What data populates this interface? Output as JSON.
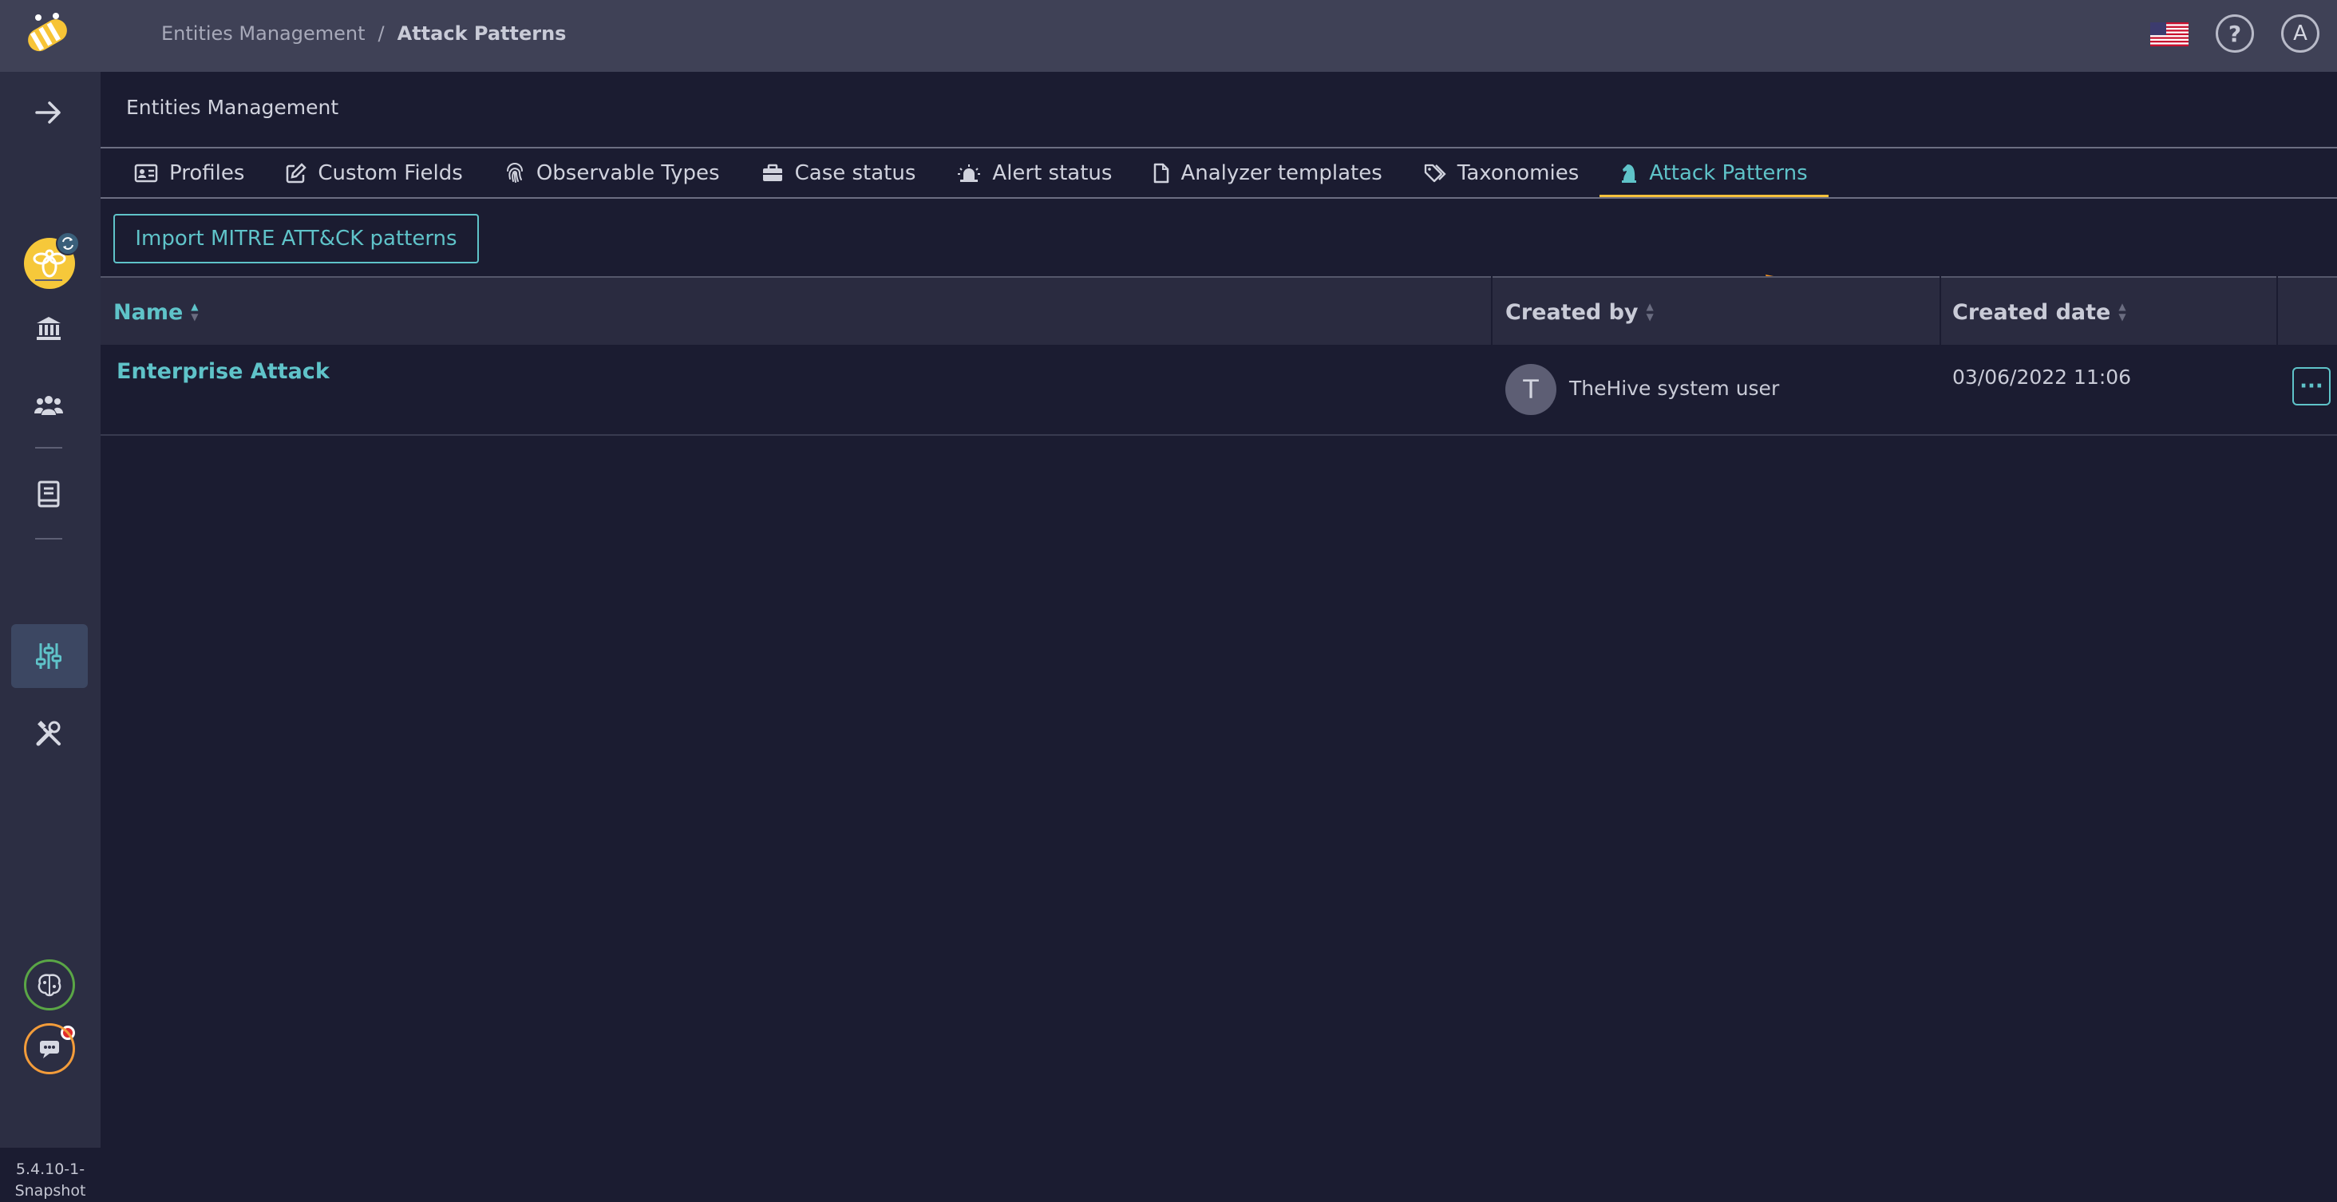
{
  "header": {
    "breadcrumb": [
      "Entities Management",
      "Attack Patterns"
    ],
    "separator": "/",
    "help_symbol": "?",
    "user_initial": "A"
  },
  "sidebar": {
    "icons": [
      "arrow-right-icon",
      "organisation-avatar",
      "institution-icon",
      "users-icon",
      "book-icon",
      "sliders-icon",
      "tools-icon"
    ],
    "active": "sliders-icon",
    "version": [
      "5.4.10-1-",
      "Snapshot"
    ]
  },
  "page": {
    "title": "Entities Management",
    "tabs": [
      {
        "label": "Profiles",
        "icon": "id-card-icon"
      },
      {
        "label": "Custom Fields",
        "icon": "edit-icon"
      },
      {
        "label": "Observable Types",
        "icon": "fingerprint-icon"
      },
      {
        "label": "Case status",
        "icon": "briefcase-icon"
      },
      {
        "label": "Alert status",
        "icon": "siren-icon"
      },
      {
        "label": "Analyzer templates",
        "icon": "file-icon"
      },
      {
        "label": "Taxonomies",
        "icon": "tags-icon"
      },
      {
        "label": "Attack Patterns",
        "icon": "chess-knight-icon",
        "active": true
      }
    ],
    "import_button": "Import MITRE ATT&CK patterns"
  },
  "table": {
    "columns": [
      "Name",
      "Created by",
      "Created date"
    ],
    "rows": [
      {
        "name": "Enterprise Attack",
        "avatar_initial": "T",
        "created_by": "TheHive system user",
        "created_date": "03/06/2022 11:06",
        "actions": "···"
      }
    ]
  },
  "colors": {
    "accent": "#5fc3c9",
    "tab_underline": "#f5c13c",
    "annotation_arrow": "#f7931e",
    "background": "#1b1c31"
  }
}
